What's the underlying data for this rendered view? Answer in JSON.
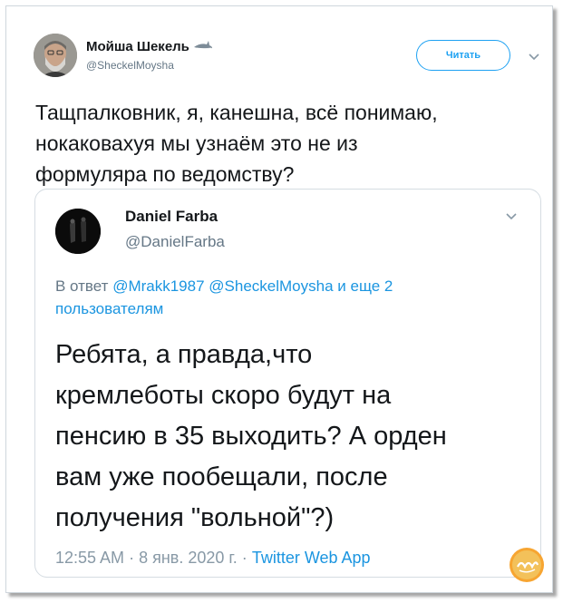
{
  "outer_tweet": {
    "author_name": "Мойша Шекель",
    "author_handle": "@SheckelMoysha",
    "follow_label": "Читать",
    "text_lines": [
      "Тащпалковник, я, канешна, всё понимаю,",
      "нокаковахуя мы узнаём это не из",
      "формуляра по ведомству?"
    ]
  },
  "quoted_tweet": {
    "author_name": "Daniel Farba",
    "author_handle": "@DanielFarba",
    "reply_prefix": "В ответ",
    "reply_mention_1": "@Mrakk1987",
    "reply_mention_2": "@SheckelMoysha",
    "reply_others": "и еще 2",
    "reply_others_line2": "пользователям",
    "text_lines": [
      "Ребята, а правда,что",
      "кремлеботы скоро будут на",
      "пенсию в 35 выходить? А орден",
      "вам уже пообещали, после",
      "получения \"вольной\"?)"
    ],
    "time": "12:55 AM",
    "separator": "·",
    "date": "8 янв. 2020 г.",
    "via": "Twitter Web App"
  },
  "colors": {
    "accent": "#1da1f2",
    "link": "#1b95e0",
    "secondary_text": "#657786",
    "primary_text": "#14171a"
  },
  "icons": {
    "shark_icon": "shark-emoji",
    "caret": "chevron-down-icon",
    "watermark": "yuka-logo"
  }
}
